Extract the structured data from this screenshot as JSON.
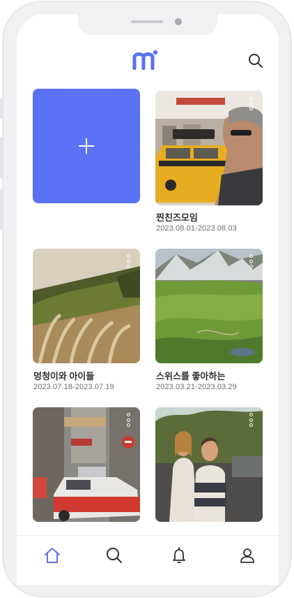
{
  "app": {
    "logo_text": "mi",
    "accent_color": "#5b72f6"
  },
  "header": {
    "search_icon": "search-icon"
  },
  "add_card": {
    "icon": "plus-icon"
  },
  "albums": [
    {
      "title": "찐친즈모임",
      "dates": "2023.08.01-2023.08.03",
      "menu_icon": "more-vertical-icon"
    },
    {
      "title": "멍청이와 아이들",
      "dates": "2023.07.18-2023.07.19",
      "menu_icon": "more-vertical-icon"
    },
    {
      "title": "스위스를 좋아하는",
      "dates": "2023.03.21-2023.03.29",
      "menu_icon": "more-vertical-icon"
    },
    {
      "title": "",
      "dates": "",
      "menu_icon": "more-vertical-icon"
    },
    {
      "title": "",
      "dates": "",
      "menu_icon": "more-vertical-icon"
    }
  ],
  "tabbar": {
    "items": [
      {
        "icon": "home-icon",
        "active": true
      },
      {
        "icon": "search-icon",
        "active": false
      },
      {
        "icon": "bell-icon",
        "active": false
      },
      {
        "icon": "user-icon",
        "active": false
      }
    ]
  }
}
